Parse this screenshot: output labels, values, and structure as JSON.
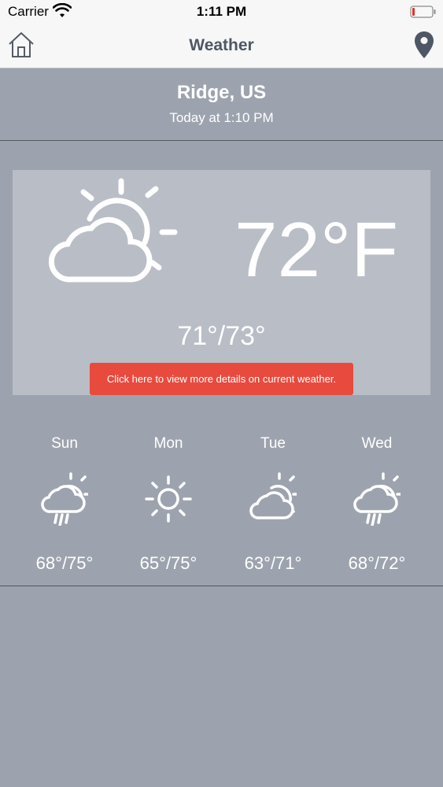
{
  "status_bar": {
    "carrier": "Carrier",
    "time": "1:11 PM"
  },
  "nav": {
    "title": "Weather",
    "left_icon": "home-icon",
    "right_icon": "location-pin-icon"
  },
  "location": {
    "city": "Ridge, US",
    "updated": "Today at 1:10 PM"
  },
  "current": {
    "icon": "partly-cloudy-icon",
    "temperature": "72°F",
    "range": "71°/73°",
    "details_button": "Click here to view more details on current weather."
  },
  "forecast": [
    {
      "day": "Sun",
      "icon": "rain-icon",
      "range": "68°/75°"
    },
    {
      "day": "Mon",
      "icon": "sunny-icon",
      "range": "65°/75°"
    },
    {
      "day": "Tue",
      "icon": "partly-cloudy-icon",
      "range": "63°/71°"
    },
    {
      "day": "Wed",
      "icon": "rain-icon",
      "range": "68°/72°"
    }
  ],
  "colors": {
    "background": "#9da3ae",
    "card": "#b9bdc6",
    "button": "#e84a3e",
    "title": "#4e5764"
  }
}
